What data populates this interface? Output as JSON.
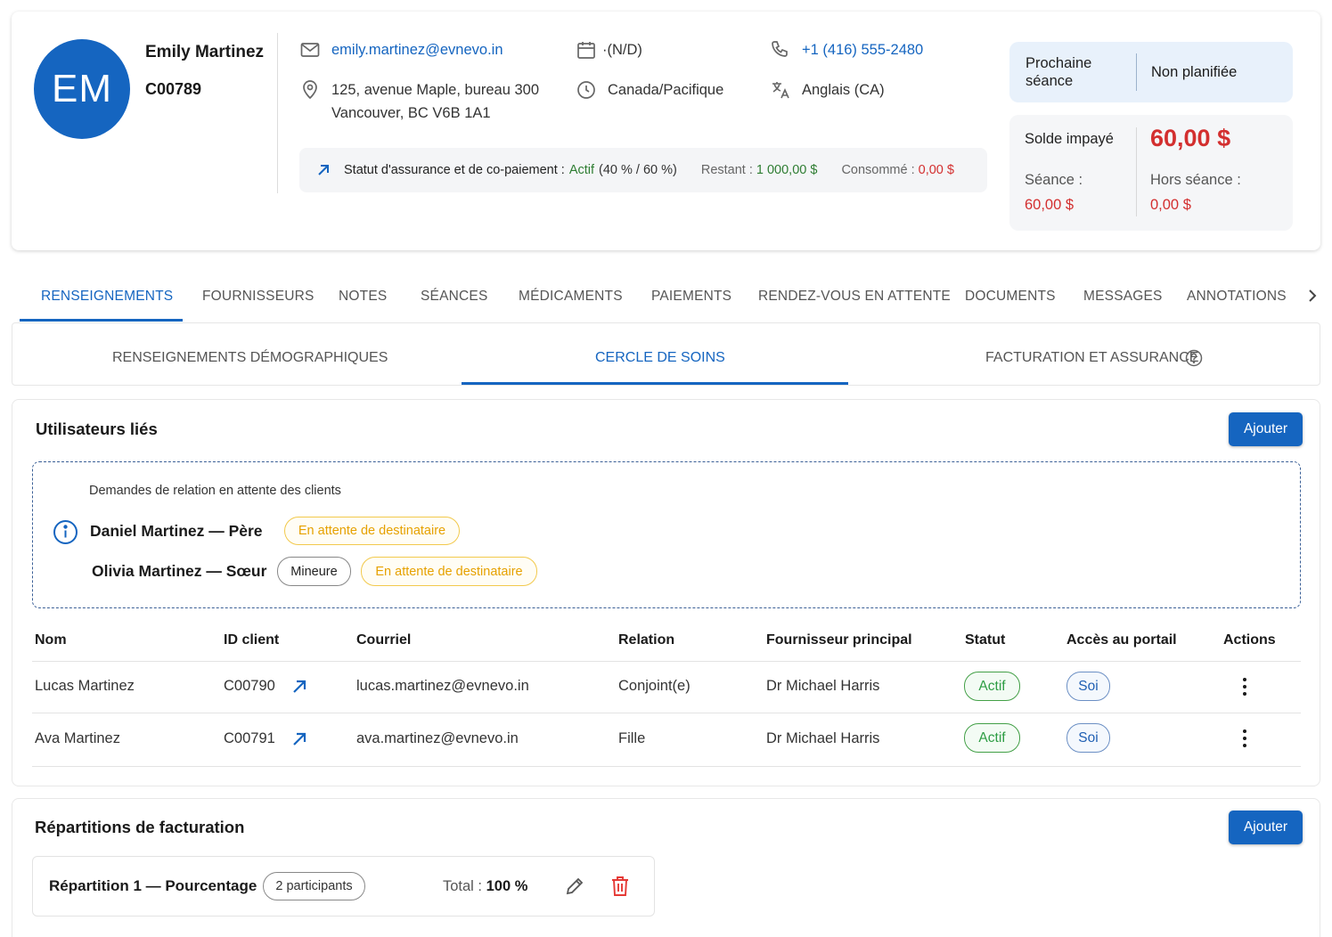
{
  "client": {
    "initials": "EM",
    "name": "Emily Martinez",
    "id": "C00789",
    "email": "emily.martinez@evnevo.in",
    "address_line1": "125, avenue Maple, bureau 300",
    "address_line2": "Vancouver, BC V6B 1A1",
    "dob": "·(N/D)",
    "timezone": "Canada/Pacifique",
    "phone": "+1 (416) 555-2480",
    "language": "Anglais (CA)"
  },
  "insurance": {
    "label": "Statut d'assurance et de co-paiement :",
    "status": "Actif",
    "ratio": "(40 % / 60 %)",
    "remaining_label": "Restant :",
    "remaining_value": "1 000,00 $",
    "consumed_label": "Consommé :",
    "consumed_value": "0,00 $"
  },
  "next_session": {
    "label": "Prochaine séance",
    "value": "Non planifiée"
  },
  "balance": {
    "label": "Solde impayé",
    "value": "60,00 $",
    "session_label": "Séance :",
    "session_value": "60,00 $",
    "off_session_label": "Hors séance :",
    "off_session_value": "0,00 $"
  },
  "tabs": [
    {
      "label": "RENSEIGNEMENTS"
    },
    {
      "label": "FOURNISSEURS"
    },
    {
      "label": "NOTES"
    },
    {
      "label": "SÉANCES"
    },
    {
      "label": "MÉDICAMENTS"
    },
    {
      "label": "PAIEMENTS"
    },
    {
      "label": "RENDEZ-VOUS EN ATTENTE"
    },
    {
      "label": "DOCUMENTS"
    },
    {
      "label": "MESSAGES"
    },
    {
      "label": "ANNOTATIONS"
    }
  ],
  "subtabs": [
    {
      "label": "RENSEIGNEMENTS DÉMOGRAPHIQUES"
    },
    {
      "label": "CERCLE DE SOINS"
    },
    {
      "label": "FACTURATION ET ASSURANCE"
    }
  ],
  "linked_users": {
    "title": "Utilisateurs liés",
    "add_label": "Ajouter",
    "pending_title": "Demandes de relation en attente des clients",
    "pending": [
      {
        "name": "Daniel Martinez — Père",
        "badges": [
          "En attente de destinataire"
        ]
      },
      {
        "name": "Olivia Martinez — Sœur",
        "minor_badge": "Mineure",
        "badges": [
          "En attente de destinataire"
        ]
      }
    ],
    "columns": [
      "Nom",
      "ID client",
      "Courriel",
      "Relation",
      "Fournisseur principal",
      "Statut",
      "Accès au portail",
      "Actions"
    ],
    "rows": [
      {
        "name": "Lucas Martinez",
        "id": "C00790",
        "email": "lucas.martinez@evnevo.in",
        "relation": "Conjoint(e)",
        "provider": "Dr Michael Harris",
        "status": "Actif",
        "portal": "Soi"
      },
      {
        "name": "Ava Martinez",
        "id": "C00791",
        "email": "ava.martinez@evnevo.in",
        "relation": "Fille",
        "provider": "Dr Michael Harris",
        "status": "Actif",
        "portal": "Soi"
      }
    ]
  },
  "billing_splits": {
    "title": "Répartitions de facturation",
    "add_label": "Ajouter",
    "items": [
      {
        "name": "Répartition 1 — Pourcentage",
        "participants": "2 participants",
        "total_label": "Total :",
        "total_value": "100 %"
      }
    ]
  },
  "colors": {
    "primary": "#1565c0",
    "avatar": "#1565c0",
    "active_green": "#2e7d32",
    "debt_red": "#d32f2f",
    "pending_amber": "#e6a100"
  }
}
